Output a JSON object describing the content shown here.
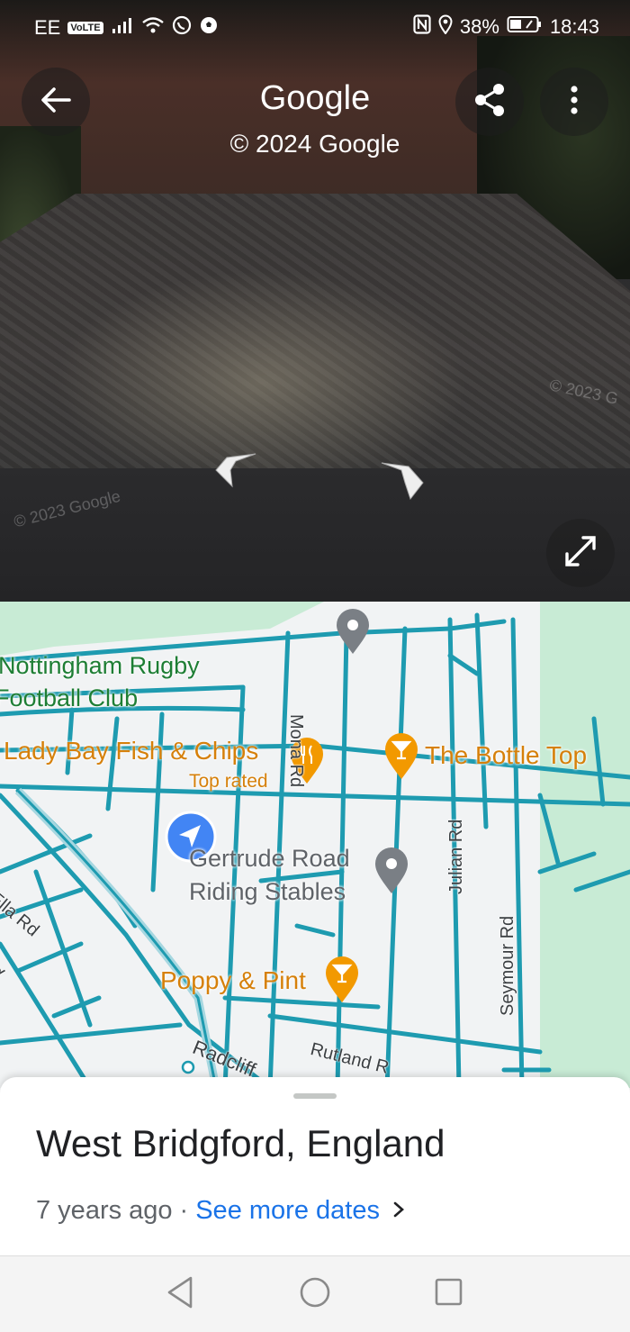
{
  "status_bar": {
    "carrier": "EE",
    "volte": "VoLTE",
    "battery_percent": "38%",
    "time": "18:43"
  },
  "street_view": {
    "title": "Google",
    "copyright": "© 2024 Google",
    "watermark_left": "© 2023 Google",
    "watermark_right": "© 2023 G",
    "icons": {
      "back": "arrow-left-icon",
      "share": "share-icon",
      "more": "more-vert-icon",
      "expand": "expand-icon",
      "nav_left": "chevron-left-icon",
      "nav_right": "chevron-right-icon"
    }
  },
  "map": {
    "labels": {
      "rugby_line1": "Nottingham Rugby",
      "rugby_line2": "Football Club",
      "fish_chips": "Lady Bay Fish & Chips",
      "top_rated": "Top rated",
      "bottle_top": "The Bottle Top",
      "stables_line1": "Gertrude Road",
      "stables_line2": "Riding Stables",
      "poppy_pint": "Poppy & Pint",
      "mona_rd": "Mona Rd",
      "julian_rd": "Julian Rd",
      "seymour_rd": "Seymour Rd",
      "ella_rd": "Ella Rd",
      "rd": "Rd",
      "radcliffe": "Radcliff",
      "rutland": "Rutland R"
    },
    "colors": {
      "roads": "#1e9bb0",
      "park": "#c8ebd5",
      "poi_orange": "#f29900",
      "poi_gray": "#7a7f85",
      "location_blue": "#4285f4"
    }
  },
  "sheet": {
    "place": "West Bridgford, England",
    "age": "7 years ago",
    "separator": "·",
    "see_more": "See more dates",
    "chevron": "›"
  },
  "nav_bar": {
    "icons": [
      "back-triangle-icon",
      "home-circle-icon",
      "recents-square-icon"
    ]
  }
}
